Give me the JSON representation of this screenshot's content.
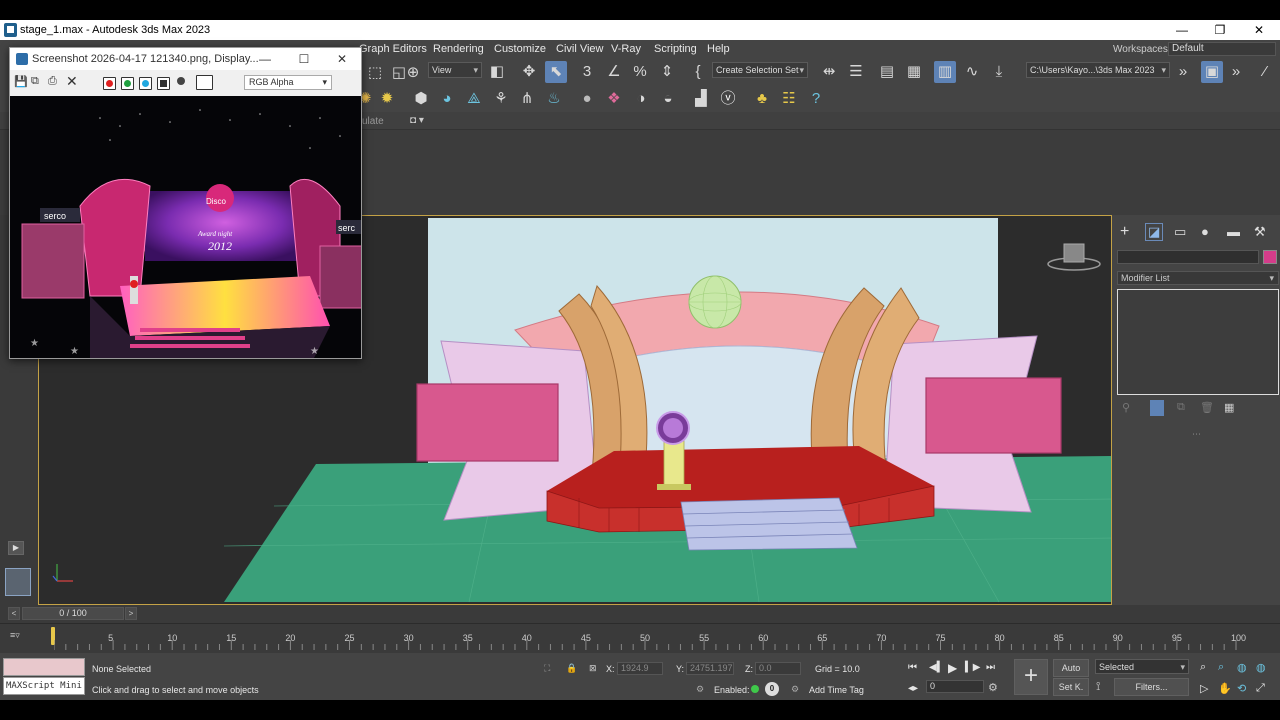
{
  "window": {
    "title": "stage_1.max - Autodesk 3ds Max 2023",
    "minimize": "—",
    "maximize": "❐",
    "close": "✕"
  },
  "menu": {
    "items": [
      "Graph Editors",
      "Rendering",
      "Customize",
      "Civil View",
      "V-Ray",
      "Scripting",
      "Help"
    ],
    "workspaces_label": "Workspaces:",
    "workspace_value": "Default"
  },
  "toolbar": {
    "view_dropdown": "View",
    "selection_set": "Create Selection Set",
    "project_path": "C:\\Users\\Kayo...\\3ds Max 2023",
    "ribbon_label": "ulate"
  },
  "frame_buffer": {
    "title": "Screenshot 2026-04-17 121340.png, Display...",
    "channel": "RGB Alpha",
    "minimize": "—",
    "maximize": "☐",
    "close": "✕",
    "sign_left": "serco",
    "sign_right": "serc",
    "disco_text": "Disco",
    "award_text": "Award night",
    "year_text": "2012"
  },
  "command_panel": {
    "modifier_list": "Modifier List"
  },
  "timeline": {
    "frame_display": "0 / 100",
    "ticks": [
      "5",
      "10",
      "15",
      "20",
      "25",
      "30",
      "35",
      "40",
      "45",
      "50",
      "55",
      "60",
      "65",
      "70",
      "75",
      "80",
      "85",
      "90",
      "95",
      "100"
    ]
  },
  "status": {
    "maxscript": "MAXScript Mini",
    "selection": "None Selected",
    "prompt": "Click and drag to select and move objects",
    "x_label": "X:",
    "x_value": "1924.9",
    "y_label": "Y:",
    "y_value": "24751.197",
    "z_label": "Z:",
    "z_value": "0.0",
    "grid": "Grid = 10.0",
    "enabled_label": "Enabled:",
    "add_time_tag": "Add Time Tag",
    "auto_key": "Auto",
    "set_key": "Set K.",
    "key_filter_dropdown": "Selected",
    "filters": "Filters...",
    "frame_spinner": "0"
  },
  "colors": {
    "accent_blue": "#5e83b6",
    "viewport_border": "#c4a246",
    "ground_green": "#3aa07a",
    "stage_pink": "#d43c8a"
  }
}
